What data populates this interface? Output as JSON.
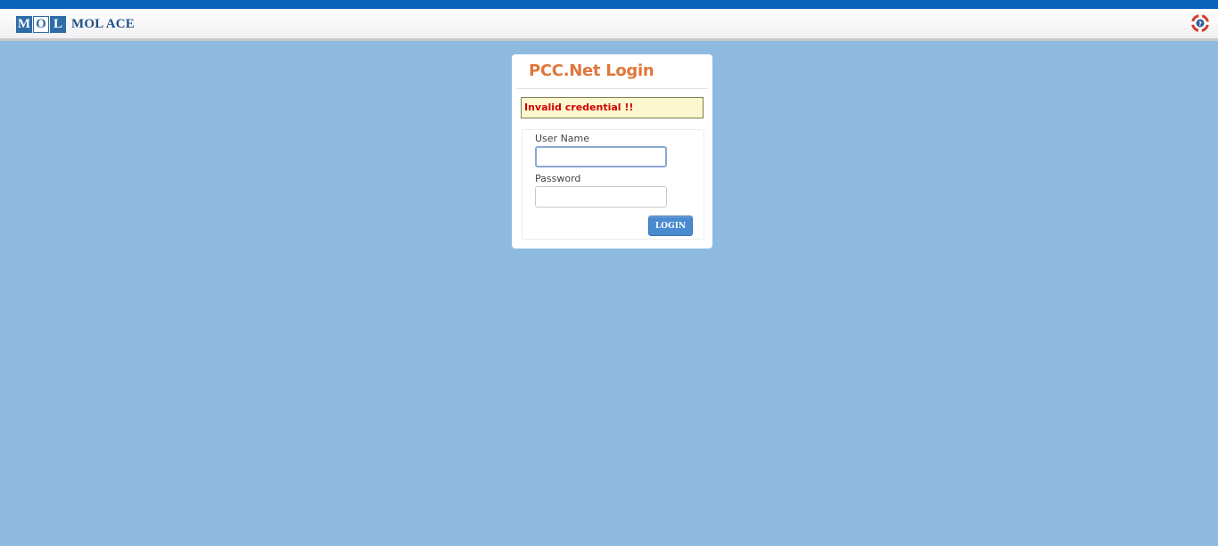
{
  "header": {
    "logo_letters": [
      "M",
      "O",
      "L"
    ],
    "logo_text": "MOL ACE",
    "help_icon": "lifebuoy-help-icon"
  },
  "login": {
    "title": "PCC.Net Login",
    "error_message": "Invalid credential !!",
    "username_label": "User Name",
    "username_value": "",
    "password_label": "Password",
    "password_value": "",
    "login_button": "LOGIN"
  },
  "colors": {
    "top_strip": "#0a64bc",
    "background": "#8fbadf",
    "title": "#e0773b",
    "error_text": "#d40000",
    "error_bg": "#fbf8cf",
    "button": "#4a8bcf",
    "logo": "#2d6ca7"
  }
}
